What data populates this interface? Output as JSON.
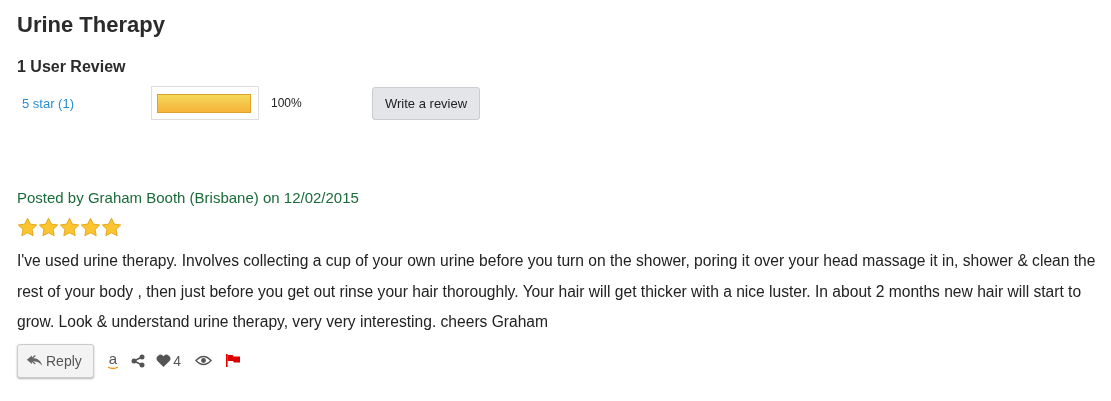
{
  "title": "Urine Therapy",
  "review_count": "1 User Review",
  "rating_rows": [
    {
      "label": "5 star (1)",
      "level": 1,
      "percent": "100%"
    }
  ],
  "write_button": "Write a review",
  "review": {
    "byline": "Posted by Graham Booth (Brisbane) on 12/02/2015",
    "stars": 5,
    "text": "I've used urine therapy. Involves collecting a cup of your own urine before you turn on the shower, poring it over your head massage it in, shower & clean the rest of your body , then just before you get out rinse your hair thoroughly. Your hair will get thicker with a nice luster. In about 2 months new hair will start to grow. Look & understand urine therapy, very very interesting. cheers Graham",
    "reply_button": "Reply",
    "shop_glyph": "a",
    "likes": "4"
  }
}
